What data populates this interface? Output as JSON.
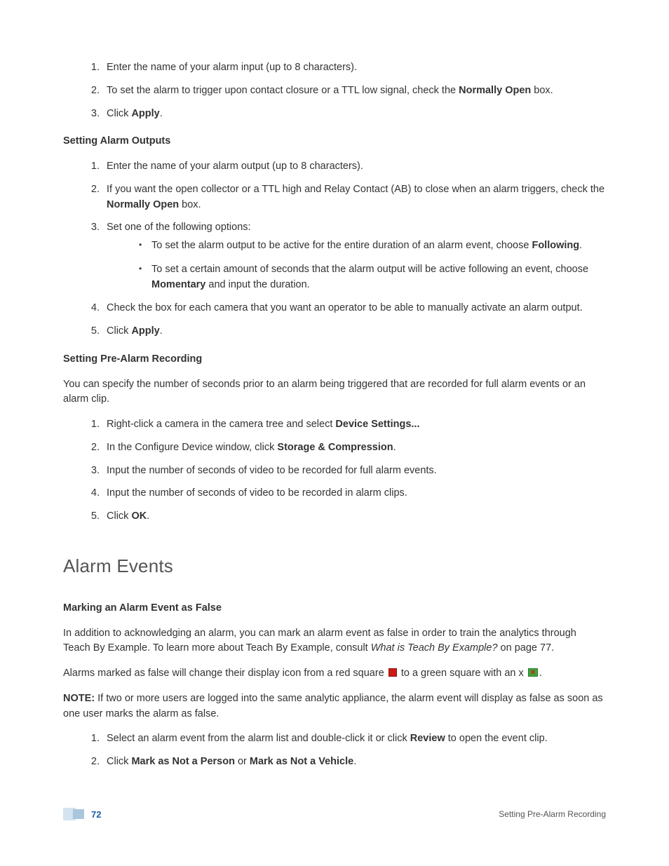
{
  "alarm_input_steps": {
    "s1": "Enter the name of your alarm input (up to 8 characters).",
    "s2a": "To set the alarm to trigger upon contact closure or a TTL low signal, check the ",
    "s2b": "Normally Open",
    "s2c": " box.",
    "s3a": "Click ",
    "s3b": "Apply",
    "s3c": "."
  },
  "setting_alarm_outputs": {
    "heading": "Setting Alarm Outputs",
    "s1": "Enter the name of your alarm output (up to 8 characters).",
    "s2a": "If you want the open collector or a TTL high and Relay Contact (AB) to close when an alarm triggers, check the ",
    "s2b": "Normally Open",
    "s2c": " box.",
    "s3": "Set one of the following options:",
    "b1a": "To set the alarm output to be active for the entire duration of an alarm event, choose ",
    "b1b": "Following",
    "b1c": ".",
    "b2a": "To set a certain amount of seconds that the alarm output will be active following an event, choose ",
    "b2b": "Momentary",
    "b2c": " and input the duration.",
    "s4": "Check the box for each camera that you want an operator to be able to manually activate an alarm output.",
    "s5a": "Click ",
    "s5b": "Apply",
    "s5c": "."
  },
  "setting_pre_alarm": {
    "heading": "Setting Pre-Alarm Recording",
    "intro": "You can specify the number of seconds prior to an alarm being triggered that are recorded for full alarm events or an alarm clip.",
    "s1a": "Right-click a camera in the camera tree and select ",
    "s1b": "Device Settings...",
    "s2a": "In the Configure Device window, click ",
    "s2b": "Storage & Compression",
    "s2c": ".",
    "s3": "Input the number of seconds of video to be recorded for full alarm events.",
    "s4": "Input the number of seconds of video to be recorded in alarm clips.",
    "s5a": "Click ",
    "s5b": "OK",
    "s5c": "."
  },
  "alarm_events": {
    "title": "Alarm Events",
    "subhead": "Marking an Alarm Event as False",
    "p1a": "In addition to acknowledging an alarm, you can mark an alarm event as false in order to train the analytics through Teach By Example. To learn more about Teach By Example, consult ",
    "p1b": "What is Teach By Example?",
    "p1c": " on page 77.",
    "p2a": "Alarms marked as false will change their display icon from a red square ",
    "p2b": " to a green square with an x ",
    "p2c": ".",
    "note_label": "NOTE:",
    "note_text": " If two or more users are logged into the same analytic appliance, the alarm event will display as false as soon as one user marks the alarm as false.",
    "s1a": "Select an alarm event from the alarm list and double-click it or click ",
    "s1b": "Review",
    "s1c": " to open the event clip.",
    "s2a": "Click ",
    "s2b": "Mark as Not a Person",
    "s2c": " or  ",
    "s2d": "Mark as Not a Vehicle",
    "s2e": "."
  },
  "footer": {
    "page_number": "72",
    "section": "Setting Pre-Alarm Recording"
  }
}
